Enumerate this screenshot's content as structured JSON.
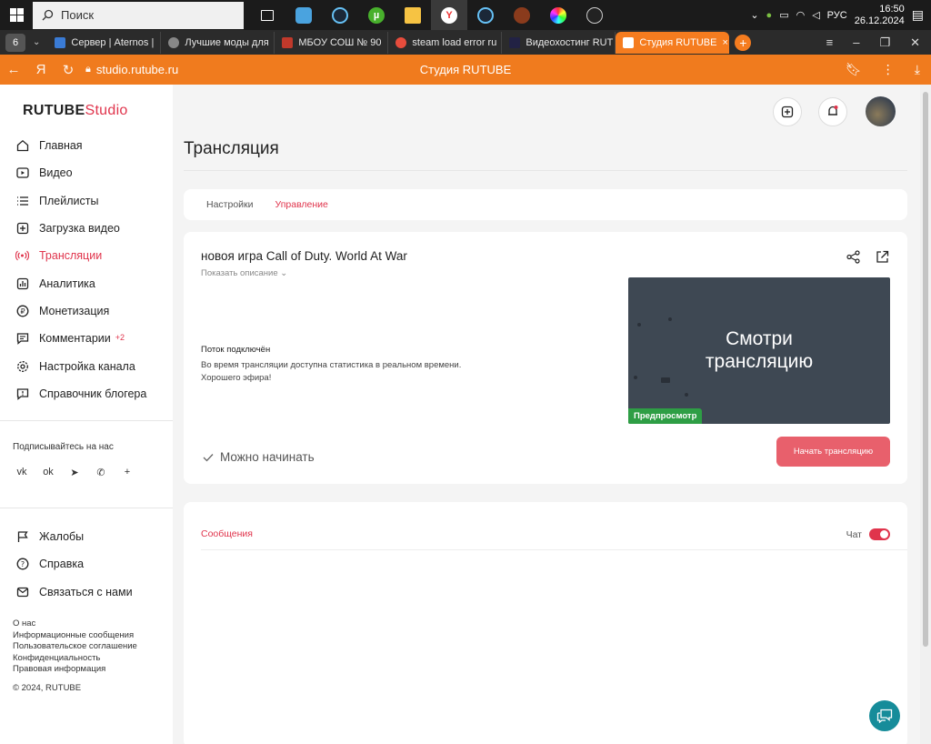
{
  "taskbar": {
    "search_placeholder": "Поиск",
    "lang": "РУС",
    "time": "16:50",
    "date": "26.12.2024"
  },
  "browser": {
    "tab_count": "6",
    "tabs": [
      {
        "label": "Сервер | Aternos |",
        "color": "#3a7bd5"
      },
      {
        "label": "Лучшие моды для",
        "color": "#888888"
      },
      {
        "label": "МБОУ СОШ № 90",
        "color": "#c0392b"
      },
      {
        "label": "steam load error ru",
        "color": "#e74c3c"
      },
      {
        "label": "Видеохостинг RUT",
        "color": "#222244"
      },
      {
        "label": "Студия RUTUBE",
        "color": "#e0344c"
      }
    ],
    "url": "studio.rutube.ru",
    "page_title": "Студия RUTUBE"
  },
  "sidebar": {
    "logo_main": "RUTUBE",
    "logo_studio": "Studio",
    "nav": [
      {
        "label": "Главная",
        "icon": "home-icon"
      },
      {
        "label": "Видео",
        "icon": "video-icon"
      },
      {
        "label": "Плейлисты",
        "icon": "playlist-icon"
      },
      {
        "label": "Загрузка видео",
        "icon": "upload-icon"
      },
      {
        "label": "Трансляции",
        "icon": "broadcast-icon"
      },
      {
        "label": "Аналитика",
        "icon": "analytics-icon"
      },
      {
        "label": "Монетизация",
        "icon": "monetization-icon"
      },
      {
        "label": "Комментарии",
        "icon": "comments-icon",
        "badge": "+2"
      },
      {
        "label": "Настройка канала",
        "icon": "gear-icon"
      },
      {
        "label": "Справочник блогера",
        "icon": "info-icon"
      }
    ],
    "subscribe_label": "Подписывайтесь на нас",
    "socials": [
      "vk-icon",
      "ok-icon",
      "telegram-icon",
      "viber-icon",
      "plus-icon"
    ],
    "nav2": [
      {
        "label": "Жалобы",
        "icon": "flag-icon"
      },
      {
        "label": "Справка",
        "icon": "help-icon"
      },
      {
        "label": "Связаться с нами",
        "icon": "mail-icon"
      }
    ],
    "footer_links": [
      "О нас",
      "Информационные сообщения",
      "Пользовательское соглашение",
      "Конфиденциальность",
      "Правовая информация"
    ],
    "copyright": "© 2024, RUTUBE"
  },
  "main": {
    "page_title": "Трансляция",
    "tabs": [
      "Настройки",
      "Управление"
    ],
    "active_tab": "Управление",
    "stream": {
      "title": "новоя игра Call of Duty. World At War",
      "show_description": "Показать описание",
      "status_head": "Поток подключён",
      "status_line1": "Во время трансляции доступна статистика в реальном времени.",
      "status_line2": "Хорошего эфира!",
      "preview_text_1": "Смотри",
      "preview_text_2": "трансляцию",
      "preview_label": "Предпросмотр",
      "ready_label": "Можно начинать",
      "start_button": "Начать трансляцию"
    },
    "chat": {
      "messages_tab": "Сообщения",
      "chat_label": "Чат",
      "chat_enabled": true
    }
  },
  "colors": {
    "accent": "#e0344c",
    "browser_orange": "#f07b1e",
    "start_button": "#e8606c",
    "preview_bg": "#3e4853",
    "preview_label": "#2e9e45",
    "help_fab": "#168c9a"
  }
}
